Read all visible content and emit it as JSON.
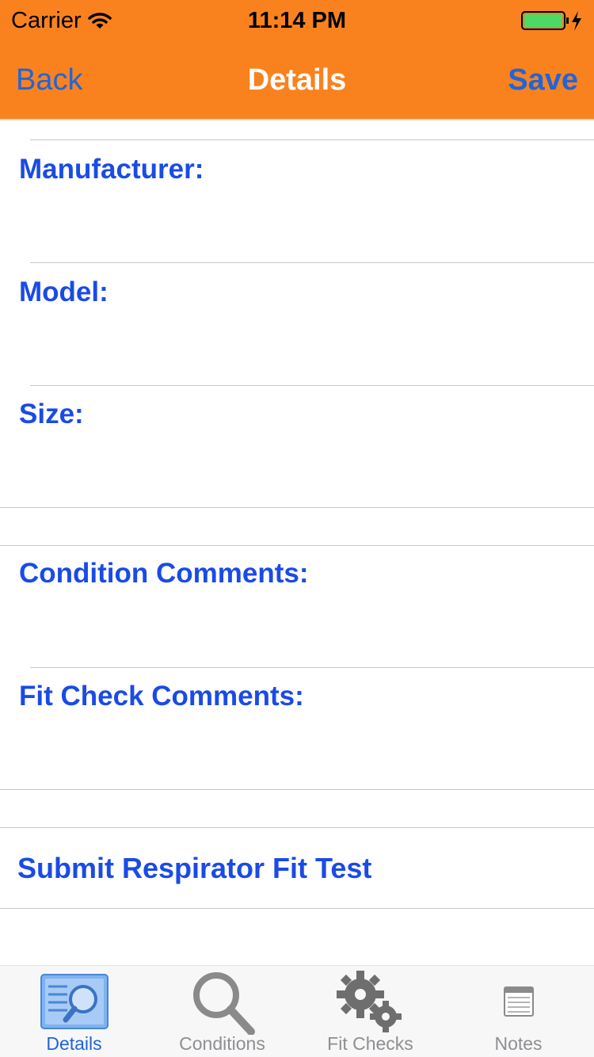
{
  "status_bar": {
    "carrier": "Carrier",
    "time": "11:14 PM"
  },
  "nav": {
    "back_label": "Back",
    "title": "Details",
    "save_label": "Save",
    "background": "#f9821f",
    "link_color": "#2065d8"
  },
  "fields": {
    "manufacturer": "Manufacturer:",
    "model": "Model:",
    "size": "Size:",
    "condition_comments": "Condition Comments:",
    "fit_check_comments": "Fit Check Comments:"
  },
  "actions": {
    "submit_label": "Submit Respirator Fit Test"
  },
  "tabbar": {
    "active": "Details",
    "tabs": [
      {
        "label": "Details",
        "icon": "details-document-magnifier-icon"
      },
      {
        "label": "Conditions",
        "icon": "magnifying-glass-icon"
      },
      {
        "label": "Fit Checks",
        "icon": "gears-icon"
      },
      {
        "label": "Notes",
        "icon": "notepad-icon"
      }
    ]
  },
  "colors": {
    "label_blue": "#1a4be6",
    "separator": "#c8c7cc",
    "tab_active": "#2065d8",
    "tab_inactive": "#8e8e93"
  }
}
